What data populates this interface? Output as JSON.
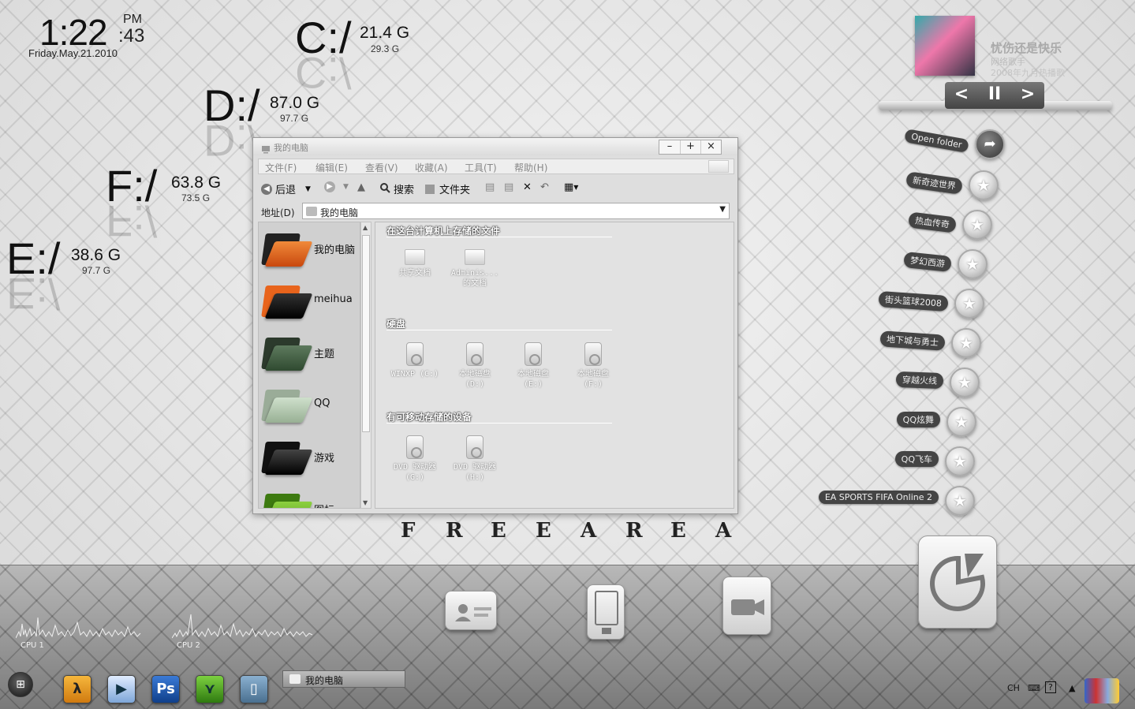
{
  "clock": {
    "hm": "1:22",
    "sec": ":43",
    "ampm": "PM",
    "date": "Friday.May.21.2010"
  },
  "drives": [
    {
      "letter": "C:/",
      "free": "21.4 G",
      "total": "29.3 G"
    },
    {
      "letter": "D:/",
      "free": "87.0 G",
      "total": "97.7 G"
    },
    {
      "letter": "F:/",
      "free": "63.8 G",
      "total": "73.5 G"
    },
    {
      "letter": "E:/",
      "free": "38.6 G",
      "total": "97.7 G"
    }
  ],
  "window": {
    "title": "我的电脑",
    "buttons": [
      "–",
      "+",
      "×"
    ],
    "menu": [
      "文件(F)",
      "编辑(E)",
      "查看(V)",
      "收藏(A)",
      "工具(T)",
      "帮助(H)"
    ],
    "toolbar": {
      "back": "后退",
      "search": "搜索",
      "folders": "文件夹"
    },
    "address_label": "地址(D)",
    "address_value": "我的电脑",
    "sidebar": [
      "我的电脑",
      "meihua",
      "主题",
      "QQ",
      "游戏",
      "图标"
    ],
    "sections": [
      {
        "title": "在这台计算机上存储的文件",
        "items": [
          [
            "共享文档"
          ],
          [
            "Adminis...",
            "的文档"
          ]
        ]
      },
      {
        "title": "硬盘",
        "items": [
          [
            "WINXP (C:)"
          ],
          [
            "本地磁盘",
            "(D:)"
          ],
          [
            "本地磁盘",
            "(E:)"
          ],
          [
            "本地磁盘",
            "(F:)"
          ]
        ]
      },
      {
        "title": "有可移动存储的设备",
        "items": [
          [
            "DVD 驱动器",
            "(G:)"
          ],
          [
            "DVD 驱动器",
            "(H:)"
          ]
        ]
      }
    ]
  },
  "freearea": [
    "F",
    "R",
    "E",
    "E",
    "A",
    "R",
    "E",
    "A"
  ],
  "music": {
    "song": "忧伤还是快乐",
    "artist": "网络歌手",
    "album": "2008年九月热播歌",
    "controls": [
      "<",
      "II",
      ">"
    ]
  },
  "launchers": [
    "Open folder",
    "新奇迹世界",
    "热血传奇",
    "梦幻西游",
    "街头篮球2008",
    "地下城与勇士",
    "穿越火线",
    "QQ炫舞",
    "QQ飞车",
    "EA SPORTS FIFA Online 2"
  ],
  "cpu": [
    "CPU 1",
    "CPU 2"
  ],
  "taskbar": {
    "quicklaunch": [
      "λ",
      "▶",
      "Ps",
      "⋎",
      "▯"
    ],
    "open_window": "我的电脑",
    "lang": "CH"
  },
  "colors": {
    "accent_orange": "#e8641c",
    "folder_green": "#5aa020",
    "music_bar": "#555555"
  }
}
